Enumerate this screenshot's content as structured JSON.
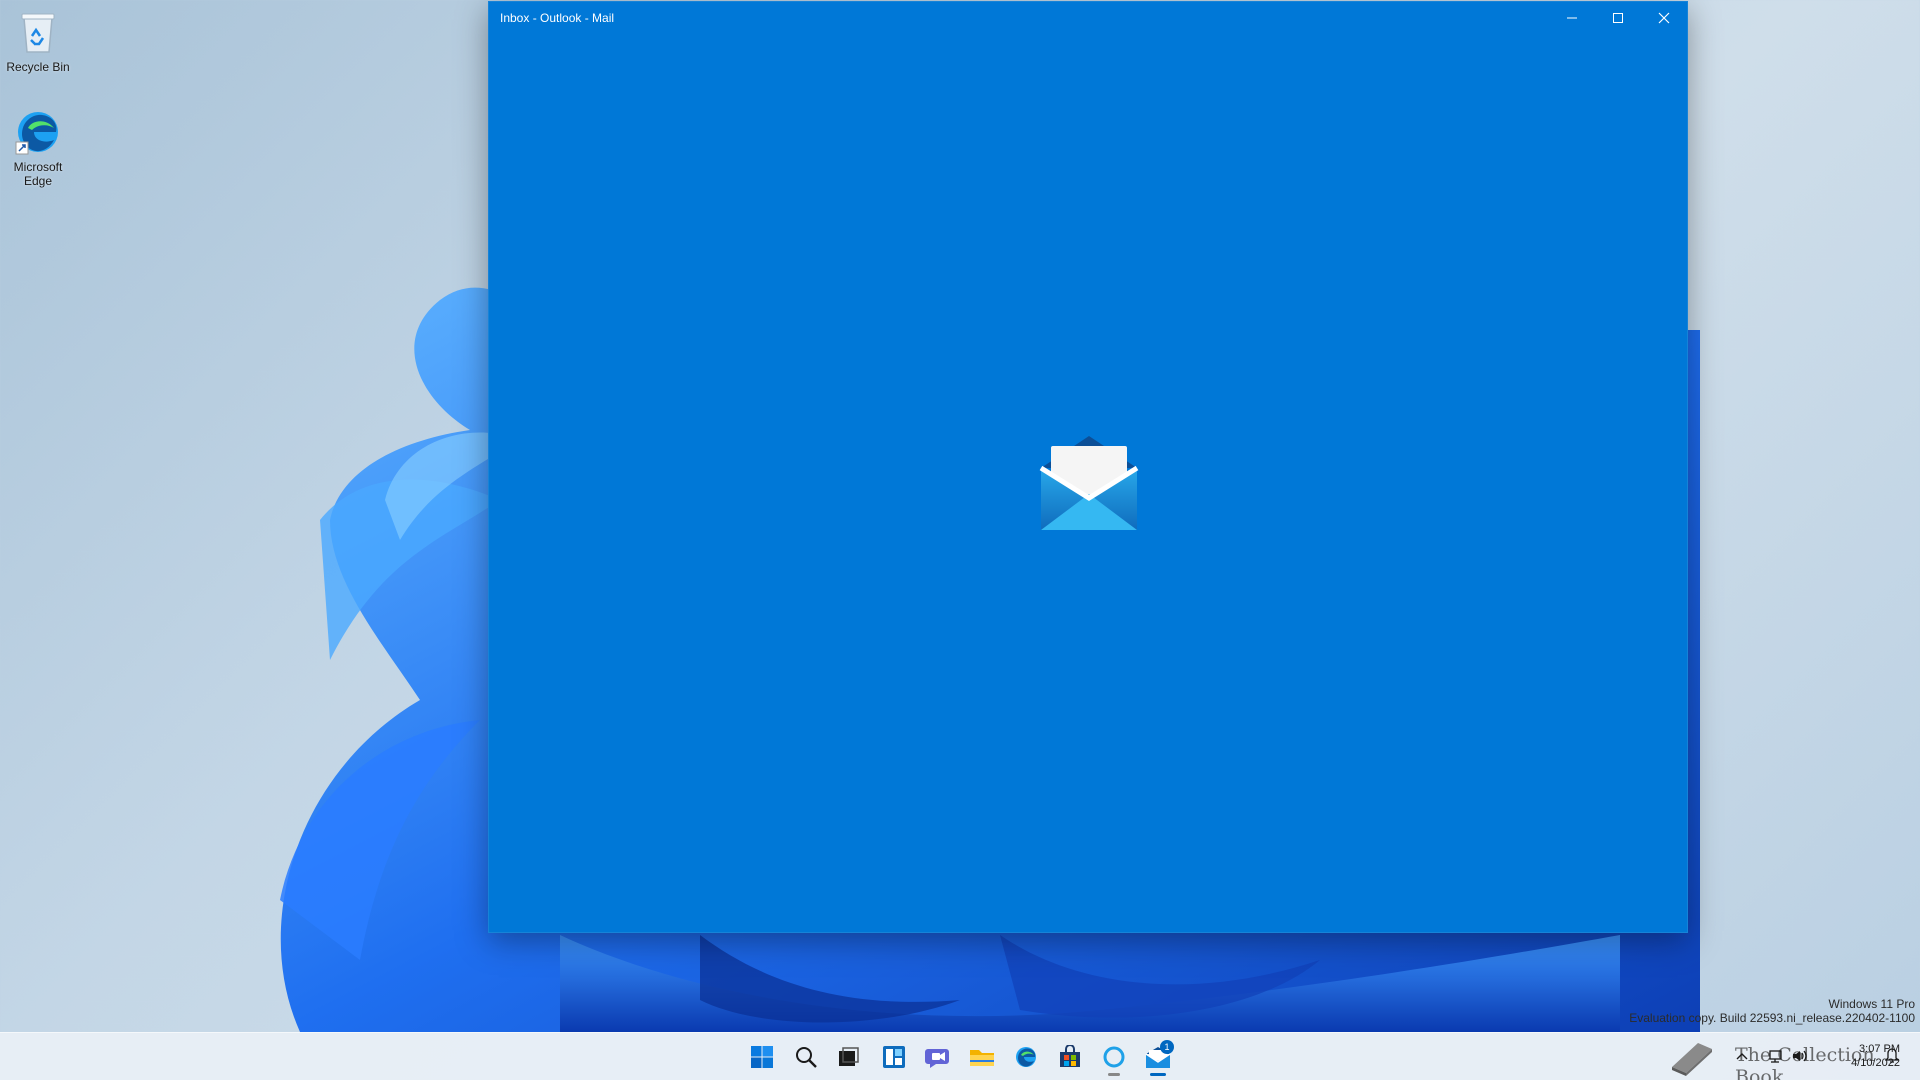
{
  "desktop": {
    "icons": [
      {
        "label": "Recycle Bin",
        "icon": "recycle-bin-icon"
      },
      {
        "label": "Microsoft Edge",
        "icon": "edge-icon"
      }
    ]
  },
  "window": {
    "title": "Inbox - Outlook - Mail",
    "background": "#0078d7",
    "splash_icon": "mail-envelope-icon",
    "controls": [
      "minimize-icon",
      "maximize-icon",
      "close-icon"
    ]
  },
  "watermark": {
    "edition": "Windows 11 Pro",
    "build": "Evaluation copy. Build 22593.ni_release.220402-1100"
  },
  "taskbar": {
    "apps": [
      {
        "name": "Start",
        "icon": "windows-start-icon"
      },
      {
        "name": "Search",
        "icon": "search-icon"
      },
      {
        "name": "Task View",
        "icon": "task-view-icon"
      },
      {
        "name": "Widgets",
        "icon": "widgets-icon"
      },
      {
        "name": "Chat",
        "icon": "chat-icon"
      },
      {
        "name": "File Explorer",
        "icon": "folder-icon"
      },
      {
        "name": "Microsoft Edge",
        "icon": "edge-icon"
      },
      {
        "name": "Microsoft Store",
        "icon": "store-icon"
      },
      {
        "name": "Cortana",
        "icon": "cortana-icon"
      },
      {
        "name": "Mail",
        "icon": "mail-icon",
        "badge": "1",
        "active": true
      }
    ],
    "overlay_text": "The Collection Book",
    "tray": [
      "chevron-up-icon",
      "network-icon",
      "volume-icon"
    ],
    "time": "3:07 PM",
    "date": "4/10/2022",
    "notification_icon": "notification-icon"
  }
}
